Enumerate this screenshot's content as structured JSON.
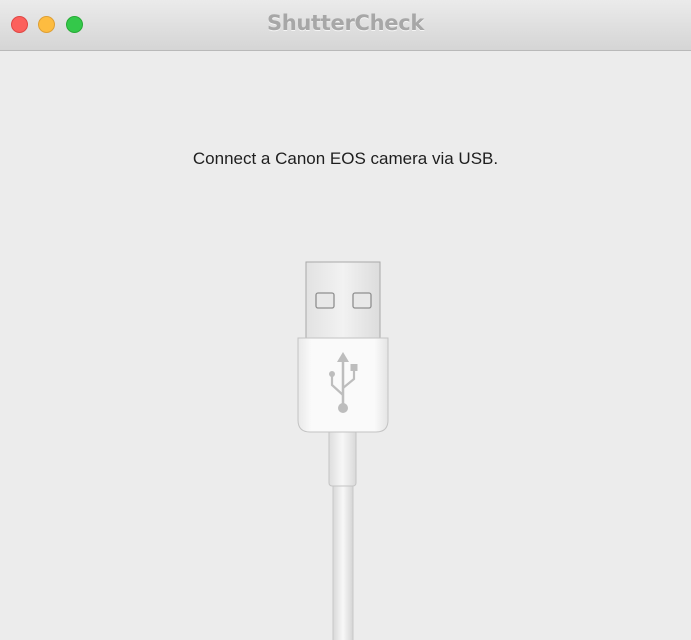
{
  "window": {
    "title": "ShutterCheck",
    "controls": {
      "close_color": "#fc605c",
      "minimize_color": "#fdbc40",
      "zoom_color": "#34c84a"
    }
  },
  "main": {
    "message": "Connect a Canon EOS camera via USB.",
    "illustration": "usb-cable-icon"
  }
}
